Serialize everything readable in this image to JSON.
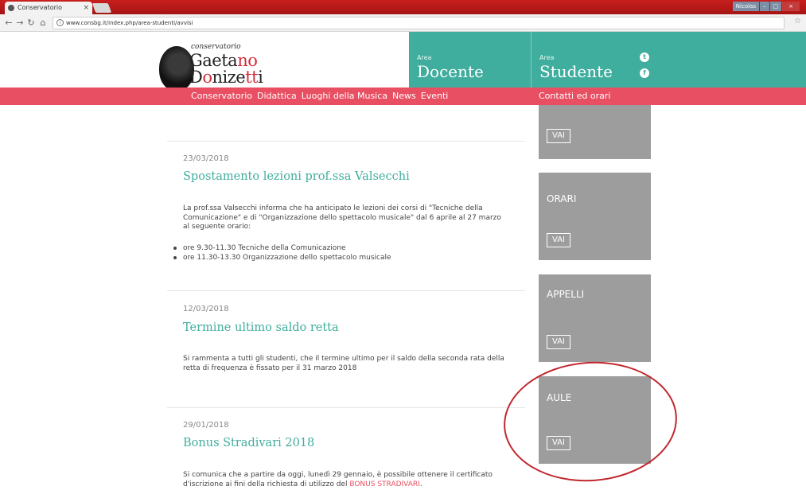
{
  "browser": {
    "tab_title": "Conservatorio",
    "tab_close": "×",
    "url": "www.consbg.it/index.php/area-studenti/avvisi",
    "window_buttons": [
      "Nicolas",
      "–",
      "□",
      "×"
    ]
  },
  "logo": {
    "small": "conservatorio",
    "line1_a": "Gaeta",
    "line1_b": "n",
    "line1_c": "o",
    "line2_a": "D",
    "line2_b": "o",
    "line2_c": "nize",
    "line2_d": "tt",
    "line2_e": "i"
  },
  "areas": {
    "docente_label": "Area",
    "docente": "Docente",
    "studente_label": "Area",
    "studente": "Studente"
  },
  "social": {
    "twitter": "t",
    "facebook": "f"
  },
  "menu": {
    "items": [
      "Conservatorio",
      "Didattica",
      "Luoghi della Musica",
      "News",
      "Eventi"
    ],
    "right": "Contatti ed orari"
  },
  "articles": [
    {
      "date": "23/03/2018",
      "title": "Spostamento lezioni prof.ssa Valsecchi",
      "body": "La prof.ssa Valsecchi informa che ha anticipato le lezioni dei corsi di \"Tecniche della Comunicazione\" e di \"Organizzazione dello spettacolo musicale\" dal 6 aprile al 27 marzo al seguente orario:",
      "list": [
        "ore 9.30-11.30 Tecniche della Comunicazione",
        "ore 11.30-13.30 Organizzazione dello spettacolo musicale"
      ]
    },
    {
      "date": "12/03/2018",
      "title": "Termine ultimo saldo retta",
      "body": "Si rammenta a tutti gli studenti, che il termine ultimo per il saldo della seconda rata della retta di frequenza è fissato per il 31 marzo 2018"
    },
    {
      "date": "29/01/2018",
      "title": "Bonus Stradivari 2018",
      "body": "Si comunica che a partire da oggi, lunedì 29 gennaio, è possibile ottenere il certificato d'iscrizione ai fini della richiesta di utilizzo del ",
      "link": "BONUS STRADIVARI",
      "body_end": "."
    }
  ],
  "cards": [
    {
      "title": "",
      "button": "VAI"
    },
    {
      "title": "ORARI",
      "button": "VAI"
    },
    {
      "title": "APPELLI",
      "button": "VAI"
    },
    {
      "title": "AULE",
      "button": "VAI"
    }
  ],
  "colors": {
    "teal": "#3fae9e",
    "menu_red": "#e84f62",
    "card_gray": "#9d9d9d",
    "annotation_red": "#c1272d"
  }
}
